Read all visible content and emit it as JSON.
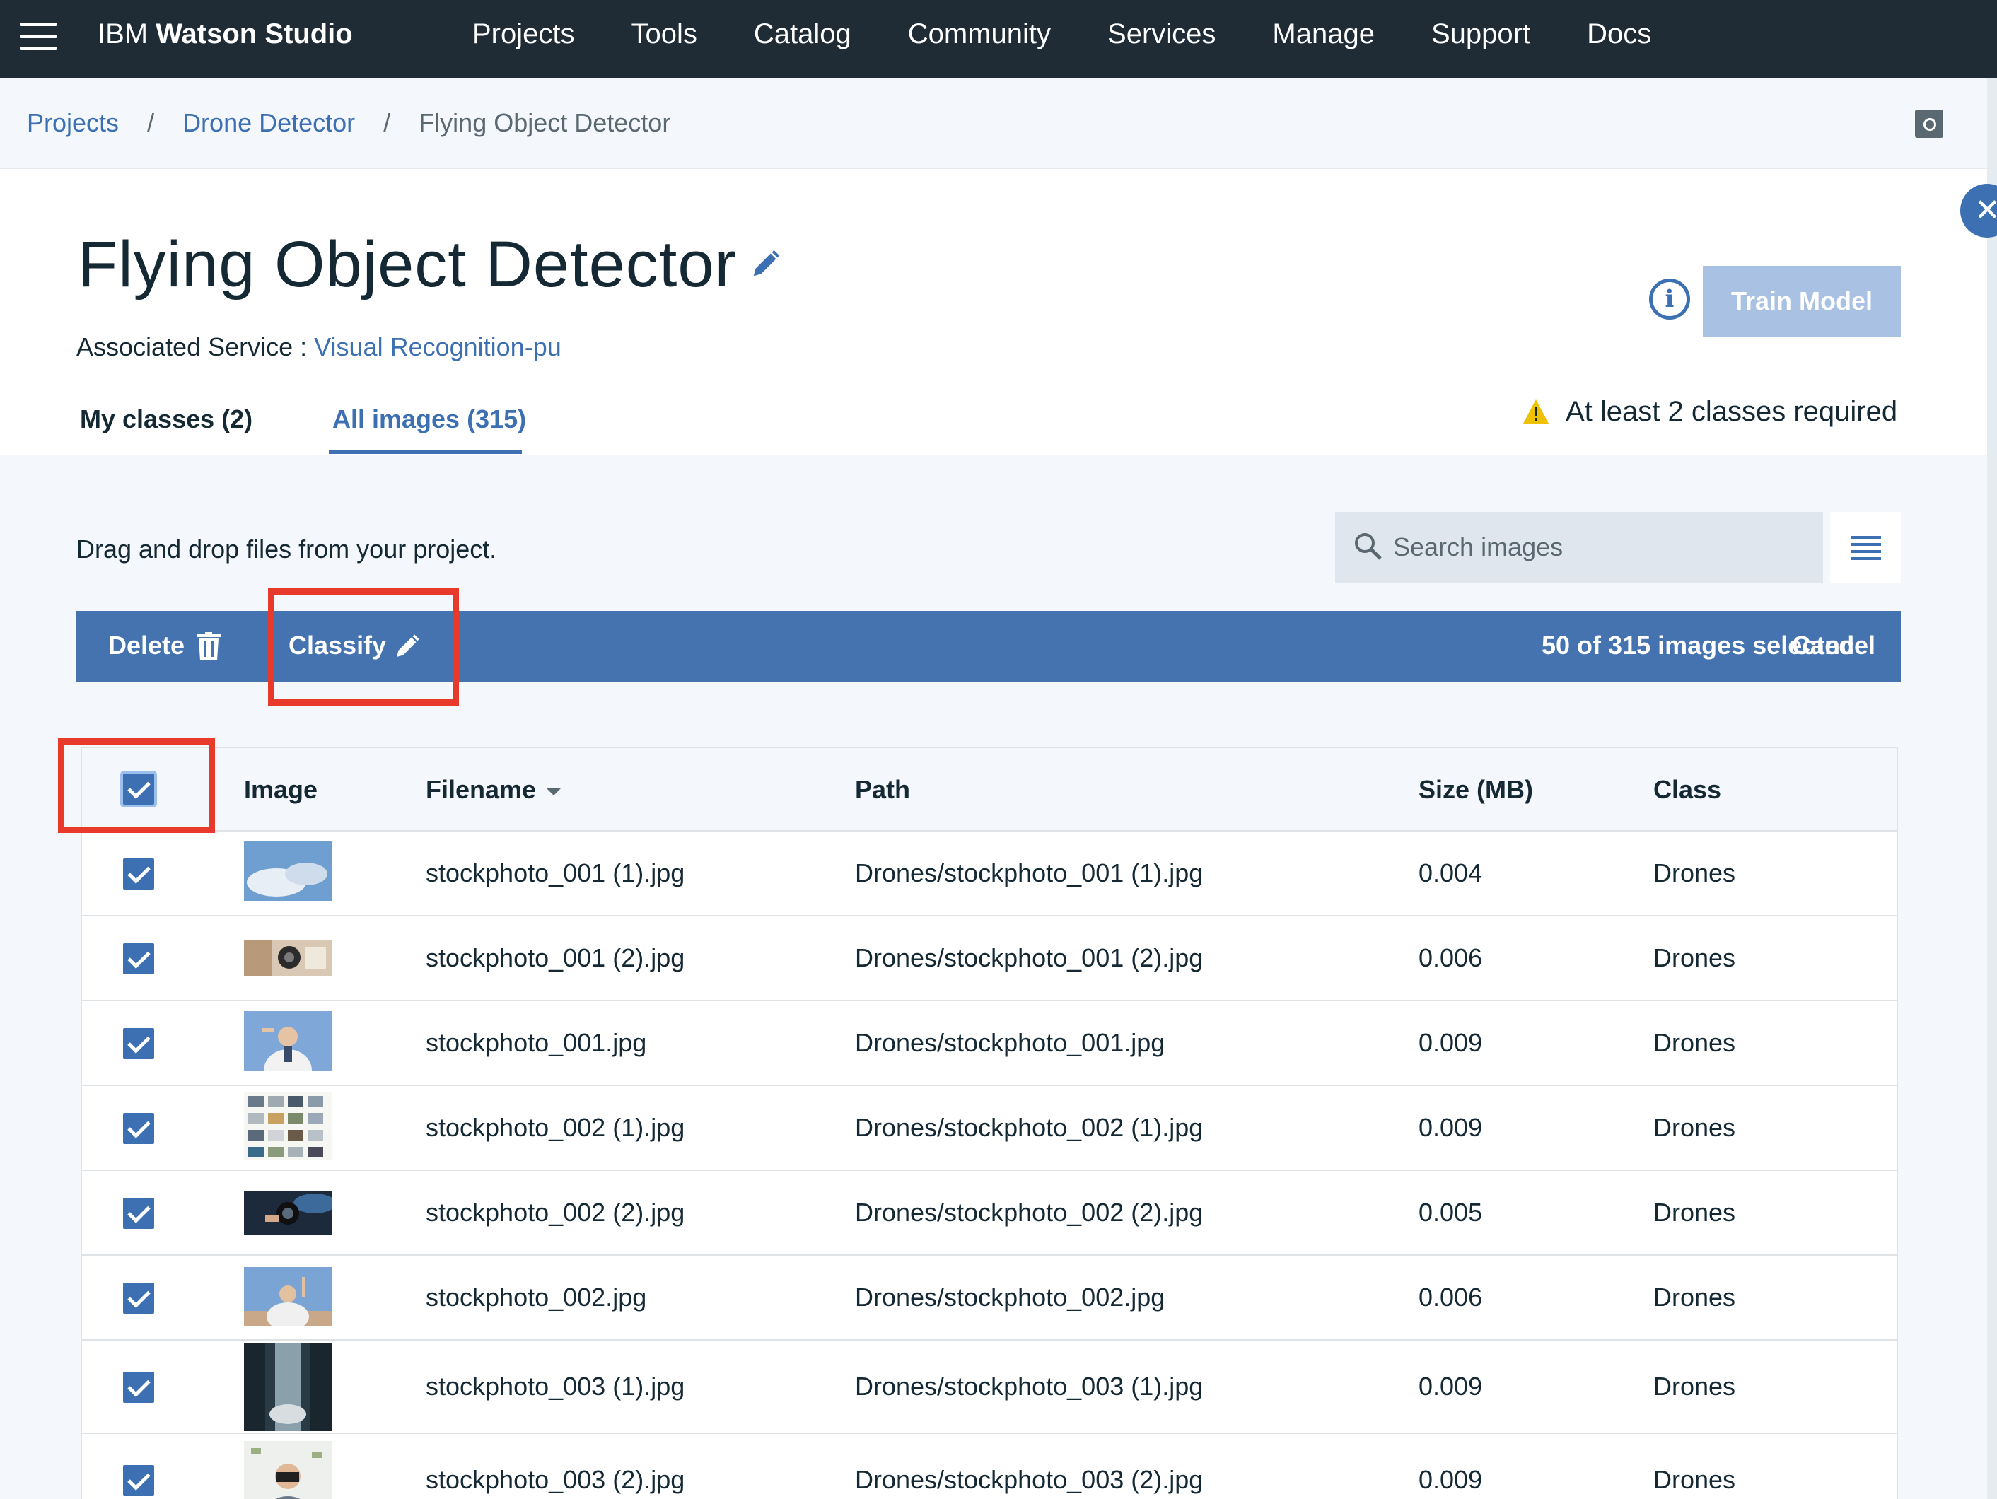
{
  "nav": {
    "brand_prefix": "IBM",
    "brand_bold": "Watson Studio",
    "items": [
      "Projects",
      "Tools",
      "Catalog",
      "Community",
      "Services",
      "Manage",
      "Support",
      "Docs"
    ]
  },
  "breadcrumb": {
    "items": [
      "Projects",
      "Drone Detector"
    ],
    "separator": "/",
    "current": "Flying Object Detector"
  },
  "header": {
    "title": "Flying Object Detector",
    "associated_label": "Associated Service :",
    "associated_service": "Visual Recognition-pu",
    "train_button": "Train Model",
    "warning": "At least 2 classes required"
  },
  "tabs": {
    "classes": "My classes (2)",
    "images": "All images (315)",
    "active": "images"
  },
  "toolbar": {
    "drag_text": "Drag and drop files from your project.",
    "search_placeholder": "Search images"
  },
  "action_bar": {
    "delete": "Delete",
    "classify": "Classify",
    "selected": "50 of 315 images selected",
    "cancel": "Cancel"
  },
  "table": {
    "headers": {
      "image": "Image",
      "filename": "Filename",
      "path": "Path",
      "size": "Size (MB)",
      "class": "Class"
    },
    "rows": [
      {
        "filename": "stockphoto_001 (1).jpg",
        "path": "Drones/stockphoto_001 (1).jpg",
        "size": "0.004",
        "class": "Drones",
        "checked": true
      },
      {
        "filename": "stockphoto_001 (2).jpg",
        "path": "Drones/stockphoto_001 (2).jpg",
        "size": "0.006",
        "class": "Drones",
        "checked": true
      },
      {
        "filename": "stockphoto_001.jpg",
        "path": "Drones/stockphoto_001.jpg",
        "size": "0.009",
        "class": "Drones",
        "checked": true
      },
      {
        "filename": "stockphoto_002 (1).jpg",
        "path": "Drones/stockphoto_002 (1).jpg",
        "size": "0.009",
        "class": "Drones",
        "checked": true
      },
      {
        "filename": "stockphoto_002 (2).jpg",
        "path": "Drones/stockphoto_002 (2).jpg",
        "size": "0.005",
        "class": "Drones",
        "checked": true
      },
      {
        "filename": "stockphoto_002.jpg",
        "path": "Drones/stockphoto_002.jpg",
        "size": "0.006",
        "class": "Drones",
        "checked": true
      },
      {
        "filename": "stockphoto_003 (1).jpg",
        "path": "Drones/stockphoto_003 (1).jpg",
        "size": "0.009",
        "class": "Drones",
        "checked": true
      },
      {
        "filename": "stockphoto_003 (2).jpg",
        "path": "Drones/stockphoto_003 (2).jpg",
        "size": "0.009",
        "class": "Drones",
        "checked": true
      }
    ]
  },
  "colors": {
    "nav_bg": "#1f2b35",
    "accent": "#3d70b2",
    "action_bar": "#4473b0",
    "train_disabled": "#a9c1e3",
    "highlight": "#e83a2b",
    "warning": "#efc100"
  },
  "icons": [
    "hamburger-icon",
    "notebook-icon",
    "close-icon",
    "edit-pencil-icon",
    "info-icon",
    "warning-icon",
    "search-icon",
    "list-view-icon",
    "trash-icon",
    "classify-pencil-icon",
    "checkbox-checked-icon",
    "sort-down-icon"
  ]
}
